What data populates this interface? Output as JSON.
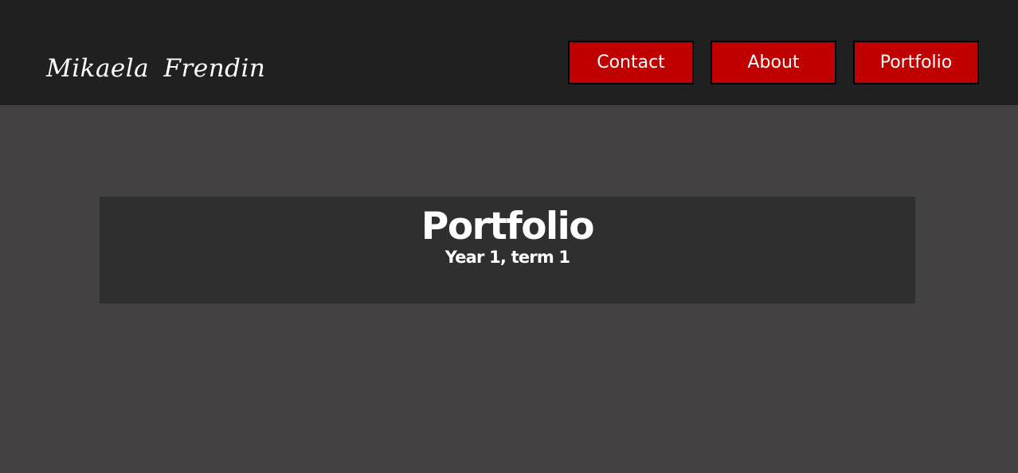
{
  "header": {
    "logo_text": "Mikaela Frendin",
    "nav": {
      "contact_label": "Contact",
      "about_label": "About",
      "portfolio_label": "Portfolio"
    }
  },
  "main": {
    "title": "Portfolio",
    "subtitle": "Year 1, term 1"
  },
  "colors": {
    "header_bg": "#202020",
    "page_bg": "#434142",
    "banner_bg": "#2f2f2f",
    "button_bg": "#c00000",
    "text": "#ffffff"
  }
}
